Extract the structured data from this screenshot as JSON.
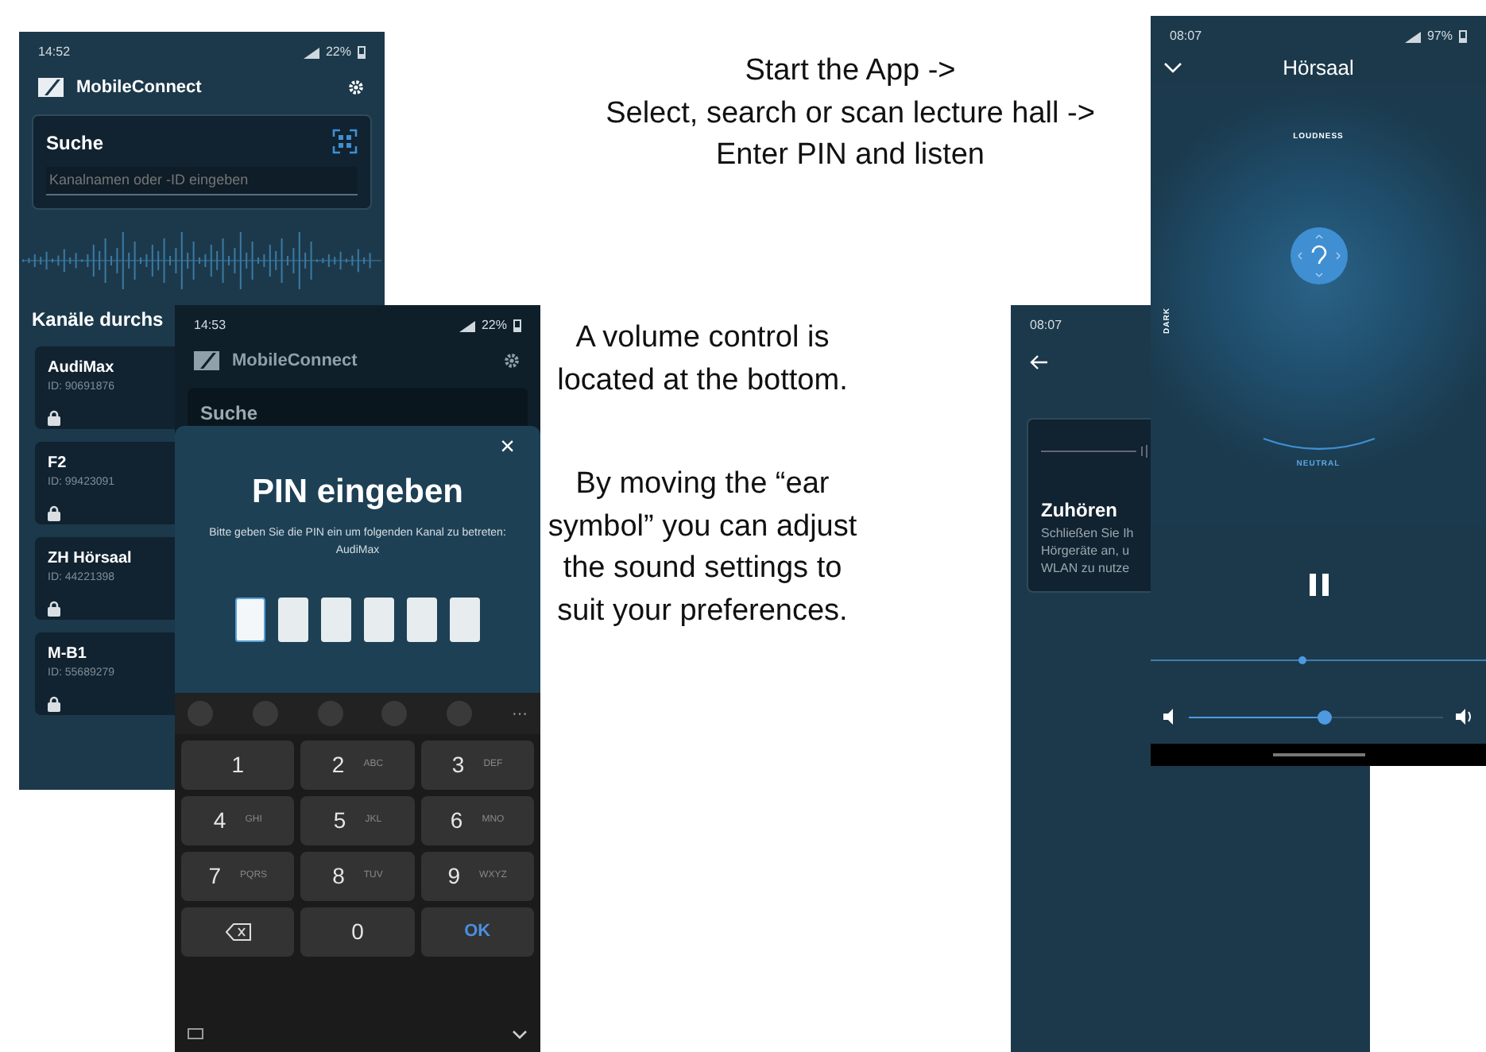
{
  "slide_text": {
    "intro_lines": [
      "Start the App ->",
      "Select, search or scan lecture hall ->",
      "Enter PIN and listen"
    ],
    "volume_note": "A volume control is located at the bottom.",
    "ear_note": "By moving the “ear symbol” you can adjust the sound settings to suit your preferences."
  },
  "search_screen": {
    "time": "14:52",
    "battery": "22%",
    "app_name": "MobileConnect",
    "search_title": "Suche",
    "search_placeholder": "Kanalnamen oder -ID eingeben",
    "section_title": "Kanäle durchs",
    "channels": [
      {
        "name": "AudiMax",
        "id": "ID: 90691876",
        "locked": true
      },
      {
        "name": "F2",
        "id": "ID: 99423091",
        "locked": true
      },
      {
        "name": "ZH Hörsaal",
        "id": "ID: 44221398",
        "locked": true
      },
      {
        "name": "M-B1",
        "id": "ID: 55689279",
        "locked": true
      }
    ]
  },
  "pin_screen": {
    "time": "14:53",
    "battery": "22%",
    "app_name": "MobileConnect",
    "search_title": "Suche",
    "close": "×",
    "title": "PIN eingeben",
    "message": "Bitte geben Sie die PIN ein um folgenden Kanal zu betreten: AudiMax",
    "pin_boxes": [
      {
        "focused": true
      },
      {
        "focused": false
      },
      {
        "focused": false
      },
      {
        "focused": false
      },
      {
        "focused": false
      },
      {
        "focused": false
      }
    ],
    "more": "···",
    "keys": [
      {
        "kind": "digit",
        "digit": "1"
      },
      {
        "kind": "digit",
        "digit": "2",
        "letters": "ABC"
      },
      {
        "kind": "digit",
        "digit": "3",
        "letters": "DEF"
      },
      {
        "kind": "digit",
        "digit": "4",
        "letters": "GHI"
      },
      {
        "kind": "digit",
        "digit": "5",
        "letters": "JKL"
      },
      {
        "kind": "digit",
        "digit": "6",
        "letters": "MNO"
      },
      {
        "kind": "digit",
        "digit": "7",
        "letters": "PQRS"
      },
      {
        "kind": "digit",
        "digit": "8",
        "letters": "TUV"
      },
      {
        "kind": "digit",
        "digit": "9",
        "letters": "WXYZ"
      },
      {
        "kind": "backspace"
      },
      {
        "kind": "digit",
        "digit": "0"
      },
      {
        "kind": "ok",
        "label": "OK"
      }
    ]
  },
  "listen_screen": {
    "time": "08:07",
    "card_title": "Zuhören",
    "card_lines": [
      "Schließen Sie Ih",
      "Hörgeräte an, u",
      "WLAN zu nutze"
    ]
  },
  "player_screen": {
    "time": "08:07",
    "battery": "97%",
    "title": "Hörsaal",
    "top_label": "LOUDNESS",
    "left_label": "DARK",
    "bottom_label": "NEUTRAL",
    "seek": {
      "level": 0.45
    },
    "volume": {
      "level": 0.53
    }
  }
}
